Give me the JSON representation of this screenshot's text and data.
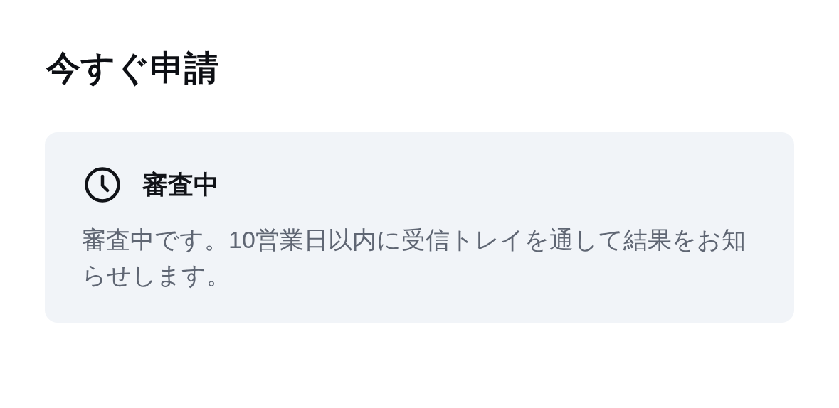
{
  "title": "今すぐ申請",
  "status": {
    "kind": "pending",
    "label": "審査中",
    "message": "審査中です。10営業日以内に受信トレイを通して結果をお知らせします。"
  }
}
